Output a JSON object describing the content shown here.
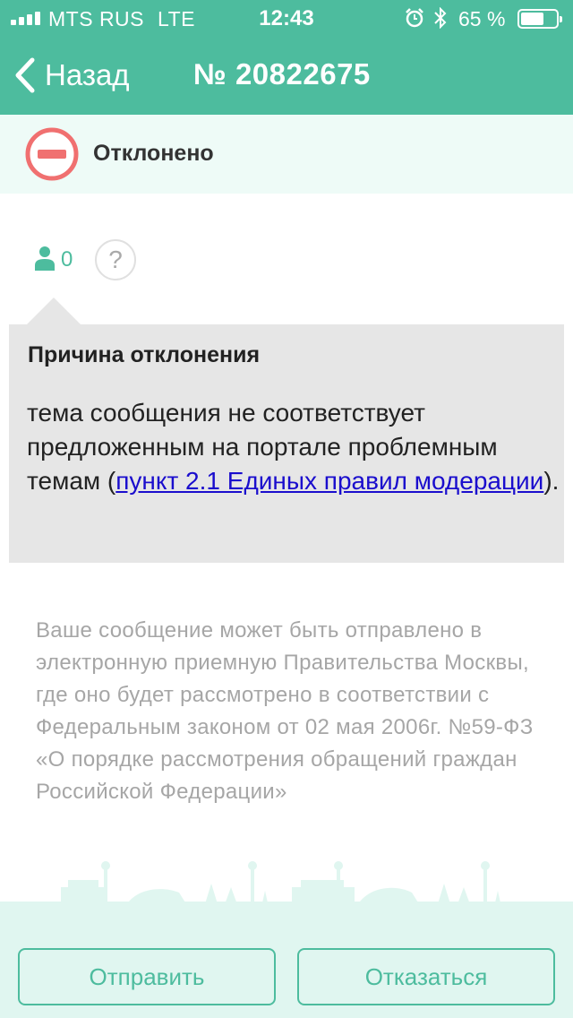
{
  "status_bar": {
    "carrier": "MTS RUS",
    "network": "LTE",
    "time": "12:43",
    "battery_percent": "65 %",
    "battery_level": 0.65
  },
  "nav": {
    "back_label": "Назад",
    "title": "№ 20822675"
  },
  "status": {
    "label": "Отклонено",
    "icon": "rejected-icon",
    "color": "#f07070"
  },
  "counter": {
    "count": "0",
    "help": "?"
  },
  "reason": {
    "title": "Причина отклонения",
    "text_before": "тема сообщения не соответствует предложенным на портале проблемным темам (",
    "link_text": "пункт 2.1 Единых правил модерации",
    "text_after": ")."
  },
  "info_text": "Ваше сообщение может быть отправлено в электронную приемную Правительства Москвы, где оно будет рассмотрено в соответствии с Федеральным законом от 02 мая 2006г. №59-ФЗ «О порядке рассмотрения обращений граждан Российской Федерации»",
  "buttons": {
    "send": "Отправить",
    "decline": "Отказаться"
  },
  "colors": {
    "accent": "#4dbc9e",
    "status_bg": "#eefbf7",
    "footer_bg": "#e0f6f0",
    "reason_bg": "#e6e6e6",
    "link": "#1a0dcd"
  }
}
